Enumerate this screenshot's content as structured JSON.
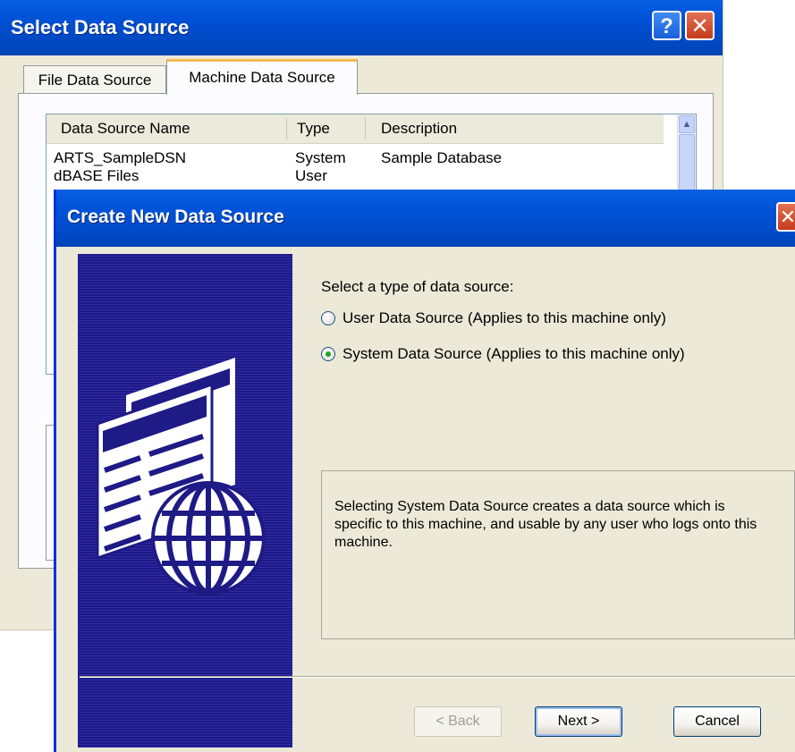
{
  "back_window": {
    "title": "Select Data Source",
    "help_glyph": "?",
    "close_glyph": "✕",
    "tabs": [
      {
        "label": "File Data Source"
      },
      {
        "label": "Machine Data Source"
      }
    ],
    "list": {
      "columns": [
        "Data Source Name",
        "Type",
        "Description"
      ],
      "rows": [
        {
          "name": "ARTS_SampleDSN",
          "type": "System",
          "description": "Sample Database"
        },
        {
          "name": "dBASE Files",
          "type": "User",
          "description": ""
        }
      ]
    }
  },
  "dialog": {
    "title": "Create New Data Source",
    "close_glyph": "✕",
    "prompt": "Select a type of data source:",
    "options": [
      {
        "label": "User Data Source (Applies to this machine only)",
        "selected": false
      },
      {
        "label": "System Data Source (Applies to this machine only)",
        "selected": true
      }
    ],
    "description": "Selecting System Data Source creates a data source which is specific to this machine, and usable by any user who logs onto this machine.",
    "buttons": {
      "back": "< Back",
      "next": "Next >",
      "cancel": "Cancel"
    }
  },
  "icons": {
    "banner": "datasource-globe-icon"
  },
  "colors": {
    "titlebar": "#0053d8",
    "banner": "#1e1a86",
    "dialog_bg": "#ece9d8"
  }
}
